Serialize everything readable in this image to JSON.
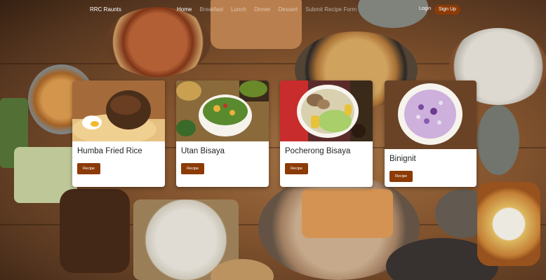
{
  "navbar": {
    "brand": "RRC Raunts",
    "links": [
      "Home",
      "Breakfast",
      "Lunch",
      "Dinner",
      "Dessert",
      "Submit Recipe Form"
    ],
    "active_link": "Home",
    "login": "Login",
    "signup": "Sign Up"
  },
  "cards": [
    {
      "title": "Humba Fried Rice",
      "button": "Recipe"
    },
    {
      "title": "Utan Bisaya",
      "button": "Recipe"
    },
    {
      "title": "Pocherong Bisaya",
      "button": "Recipe"
    },
    {
      "title": "Binignit",
      "button": "Recipe"
    }
  ],
  "colors": {
    "accent": "#8c3a06",
    "card_bg": "#ffffff",
    "nav_text": "#ffffff"
  }
}
